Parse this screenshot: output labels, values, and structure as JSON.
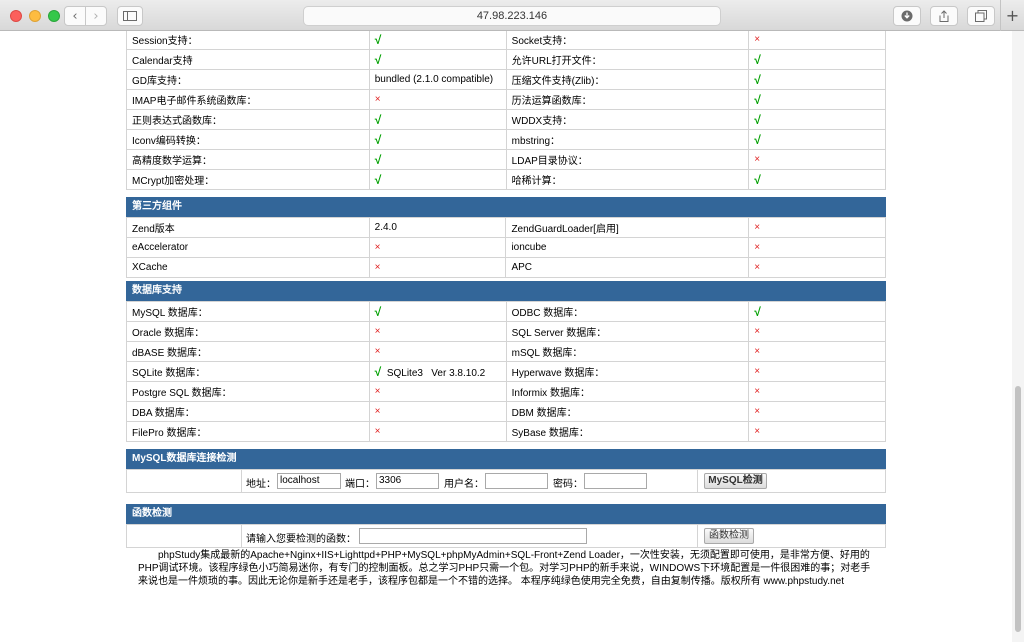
{
  "browser": {
    "address": "47.98.223.146"
  },
  "php_features": [
    [
      "Session支持：",
      "√",
      "Socket支持：",
      "×"
    ],
    [
      "Calendar支持",
      "√",
      "允许URL打开文件：",
      "√"
    ],
    [
      "GD库支持：",
      "bundled (2.1.0 compatible)",
      "压缩文件支持(Zlib)：",
      "√"
    ],
    [
      "IMAP电子邮件系统函数库：",
      "×",
      "历法运算函数库：",
      "√"
    ],
    [
      "正则表达式函数库：",
      "√",
      "WDDX支持：",
      "√"
    ],
    [
      "Iconv编码转换：",
      "√",
      "mbstring：",
      "√"
    ],
    [
      "高精度数学运算：",
      "√",
      "LDAP目录协议：",
      "×"
    ],
    [
      "MCrypt加密处理：",
      "√",
      "哈稀计算：",
      "√"
    ]
  ],
  "third_party": {
    "title": "第三方组件",
    "rows": [
      [
        "Zend版本",
        "2.4.0",
        "ZendGuardLoader[启用]",
        "×"
      ],
      [
        "eAccelerator",
        "×",
        "ioncube",
        "×"
      ],
      [
        "XCache",
        "×",
        "APC",
        "×"
      ]
    ]
  },
  "database": {
    "title": "数据库支持",
    "rows": [
      [
        "MySQL 数据库：",
        "√",
        "ODBC 数据库：",
        "√"
      ],
      [
        "Oracle 数据库：",
        "×",
        "SQL Server 数据库：",
        "×"
      ],
      [
        "dBASE 数据库：",
        "×",
        "mSQL 数据库：",
        "×"
      ],
      [
        "SQLite 数据库：",
        "√  SQLite3   Ver 3.8.10.2",
        "Hyperwave 数据库：",
        "×"
      ],
      [
        "Postgre SQL 数据库：",
        "×",
        "Informix 数据库：",
        "×"
      ],
      [
        "DBA 数据库：",
        "×",
        "DBM 数据库：",
        "×"
      ],
      [
        "FilePro 数据库：",
        "×",
        "SyBase 数据库：",
        "×"
      ]
    ]
  },
  "mysql_check": {
    "title": "MySQL数据库连接检测",
    "host_label": "地址：",
    "host_value": "localhost",
    "port_label": "端口：",
    "port_value": "3306",
    "user_label": "用户名：",
    "user_value": "",
    "pass_label": "密码：",
    "pass_value": "",
    "button": "MySQL检测"
  },
  "func_check": {
    "title": "函数检测",
    "label": "请输入您要检测的函数：",
    "value": "",
    "button": "函数检测"
  },
  "footer": "phpStudy集成最新的Apache+Nginx+IIS+Lighttpd+PHP+MySQL+phpMyAdmin+SQL-Front+Zend Loader，一次性安装，无须配置即可使用，是非常方便、好用的PHP调试环境。该程序绿色小巧简易迷你，有专门的控制面板。总之学习PHP只需一个包。对学习PHP的新手来说，WINDOWS下环境配置是一件很困难的事；对老手来说也是一件烦琐的事。因此无论你是新手还是老手，该程序包都是一个不错的选择。 本程序纯绿色使用完全免费，自由复制传播。版权所有 www.phpstudy.net",
  "colors": {
    "header_bg": "#336699",
    "yes": "#00a000",
    "no": "#e02020"
  }
}
